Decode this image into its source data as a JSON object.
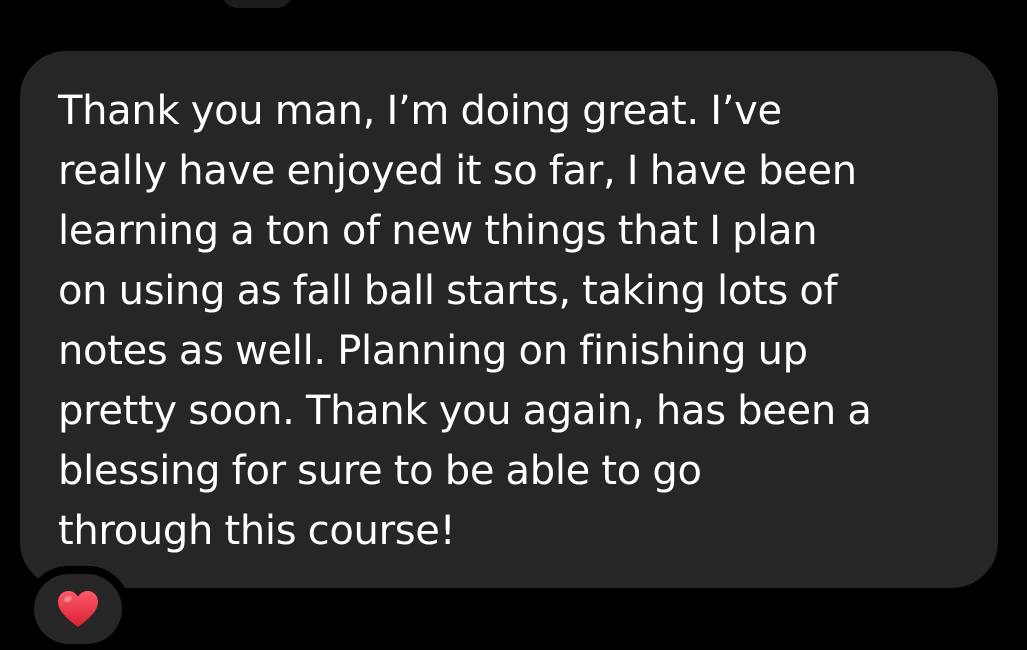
{
  "message": {
    "lines": [
      "Thank you man, I’m doing great. I’ve",
      "really have enjoyed it so far, I have been",
      "learning a ton of new things that I plan",
      "on using as fall ball starts, taking lots of",
      "notes as well. Planning on finishing up",
      "pretty soon. Thank you again, has been a",
      "blessing for sure to be able to go",
      "through this course!"
    ]
  },
  "reaction": {
    "icon": "red-heart-icon",
    "color": "#e8283c"
  },
  "colors": {
    "background": "#000000",
    "bubble": "#262626",
    "text": "#ffffff"
  }
}
